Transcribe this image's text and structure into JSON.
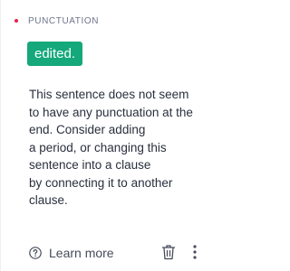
{
  "card": {
    "category": "PUNCTUATION",
    "suggestion": "edited.",
    "message_lines": [
      "This sentence does not seem",
      "to have any punctuation at the",
      "end. Consider adding",
      "a period, or changing this",
      "sentence into a clause",
      "by connecting it to another",
      "clause."
    ],
    "learn_more_label": "Learn more"
  },
  "colors": {
    "category_dot": "#e2224a",
    "suggestion_bg": "#15a87a",
    "text": "#292f3d",
    "muted": "#6d758d"
  },
  "icons": {
    "category_marker": "red-dot",
    "help": "question-circle-icon",
    "delete": "trash-icon",
    "more": "more-vertical-icon"
  }
}
